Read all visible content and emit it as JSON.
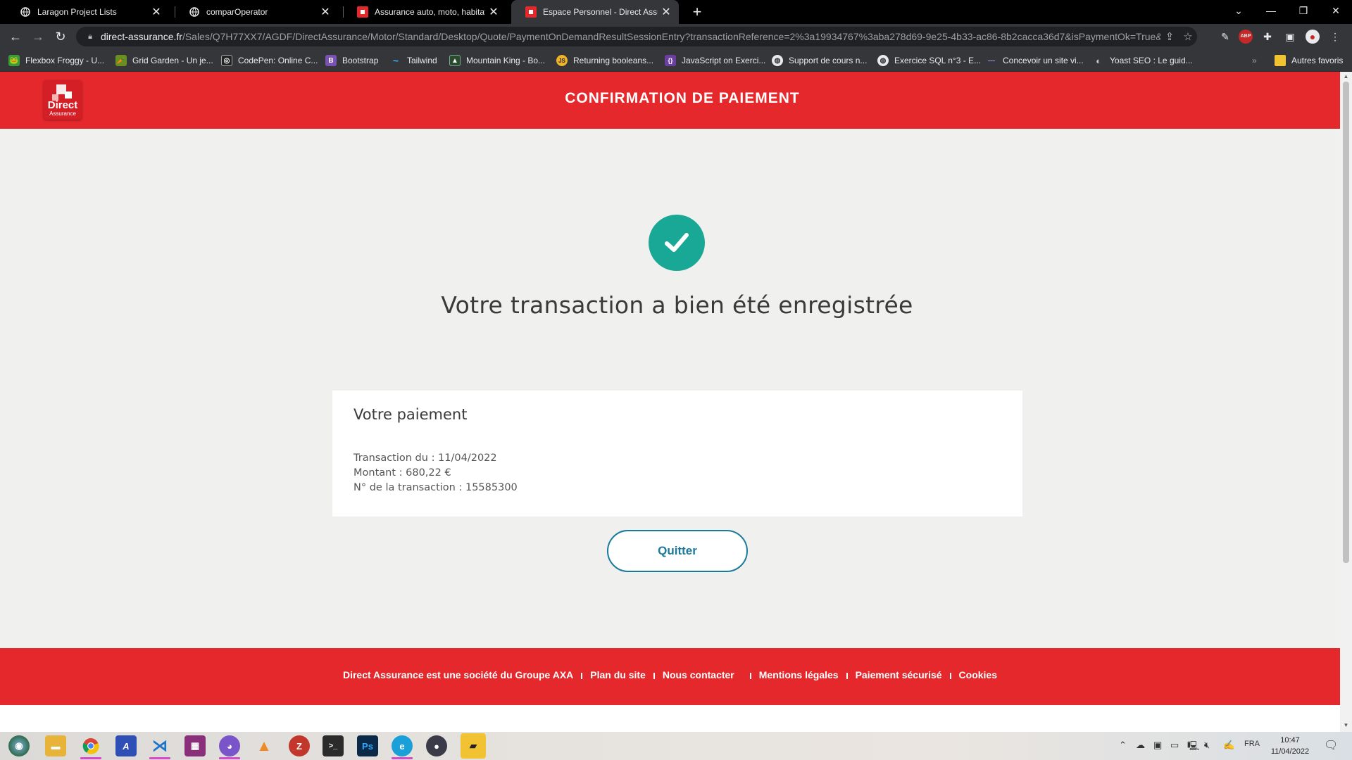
{
  "browser": {
    "tabs": [
      {
        "title": "Laragon Project Lists",
        "icon": "globe-icon",
        "active": false
      },
      {
        "title": "comparOperator",
        "icon": "globe-icon",
        "active": false
      },
      {
        "title": "Assurance auto, moto, habitation",
        "icon": "direct-assurance-icon",
        "active": false
      },
      {
        "title": "Espace Personnel - Direct Assurance",
        "icon": "direct-assurance-icon",
        "active": true
      }
    ],
    "new_tab_label": "+",
    "url_host": "direct-assurance.fr",
    "url_path": "/Sales/Q7H77XX7/AGDF/DirectAssurance/Motor/Standard/Desktop/Quote/PaymentOnDemandResultSessionEntry?transactionReference=2%3a19934767%3aba278d69-9e25-4b33-ac86-8b2cacca36d7&isPaymentOk=True&is...",
    "bookmarks": [
      {
        "label": "Flexbox Froggy - U...",
        "color": "#3a9d3a",
        "glyph": "🐸"
      },
      {
        "label": "Grid Garden - Un je...",
        "color": "#6b8e23",
        "glyph": "🥕"
      },
      {
        "label": "CodePen: Online C...",
        "color": "#222222",
        "glyph": "◎"
      },
      {
        "label": "Bootstrap",
        "color": "#7952b3",
        "glyph": "B"
      },
      {
        "label": "Tailwind",
        "color": "#38bdf8",
        "glyph": "~"
      },
      {
        "label": "Mountain King - Bo...",
        "color": "#3a6b3a",
        "glyph": "▲"
      },
      {
        "label": "Returning booleans...",
        "color": "#f0b429",
        "glyph": "JS"
      },
      {
        "label": "JavaScript on Exerci...",
        "color": "#6b3fa0",
        "glyph": "{}"
      },
      {
        "label": "Support de cours n...",
        "color": "#444444",
        "glyph": "◍"
      },
      {
        "label": "Exercice SQL n°3 - E...",
        "color": "#444444",
        "glyph": "◍"
      },
      {
        "label": "Concevoir un site vi...",
        "color": "#3d4f8a",
        "glyph": "—"
      },
      {
        "label": "Yoast SEO : Le guid...",
        "color": "#555555",
        "glyph": "◐"
      }
    ],
    "other_bookmarks": "Autres favoris"
  },
  "page": {
    "header_title": "CONFIRMATION DE PAIEMENT",
    "logo_line1": "Direct",
    "logo_line2": "Assurance",
    "headline": "Votre transaction a bien été enregistrée",
    "card": {
      "title": "Votre paiement",
      "date_line": "Transaction du : 11/04/2022",
      "amount_line": "Montant : 680,22 €",
      "ref_line": "N° de la transaction : 15585300"
    },
    "quit_button": "Quitter",
    "footer_links": [
      "Direct Assurance est une société du Groupe AXA",
      "Plan du site",
      "Nous contacter",
      "Mentions légales",
      "Paiement sécurisé",
      "Cookies"
    ],
    "brand_red": "#e4282c",
    "success_green": "#19a895",
    "button_blue": "#1a7a9c"
  },
  "taskbar": {
    "apps": [
      {
        "name": "start-orb",
        "color": "#2f6b4f",
        "glyph": "◉"
      },
      {
        "name": "file-explorer",
        "color": "#e8b339",
        "glyph": "▬"
      },
      {
        "name": "chrome",
        "color": "#db4437",
        "glyph": "◎"
      },
      {
        "name": "affinity",
        "color": "#2e4fb5",
        "glyph": "A"
      },
      {
        "name": "vscode",
        "color": "#1e74c9",
        "glyph": "⋊"
      },
      {
        "name": "winrar",
        "color": "#8a2f7a",
        "glyph": "▦"
      },
      {
        "name": "discord-like",
        "color": "#7a55c9",
        "glyph": "◕"
      },
      {
        "name": "vlc",
        "color": "#f08a24",
        "glyph": "▲"
      },
      {
        "name": "filezilla",
        "color": "#c2362b",
        "glyph": "Z"
      },
      {
        "name": "terminal",
        "color": "#2b2b2b",
        "glyph": ">_"
      },
      {
        "name": "photoshop",
        "color": "#0b2a4a",
        "glyph": "Ps"
      },
      {
        "name": "edge",
        "color": "#1aa0d8",
        "glyph": "e"
      },
      {
        "name": "obs",
        "color": "#3a3a48",
        "glyph": "●"
      },
      {
        "name": "sticky-notes",
        "color": "#f1c232",
        "glyph": "▰"
      }
    ],
    "language": "FRA",
    "time": "10:47",
    "date": "11/04/2022"
  }
}
